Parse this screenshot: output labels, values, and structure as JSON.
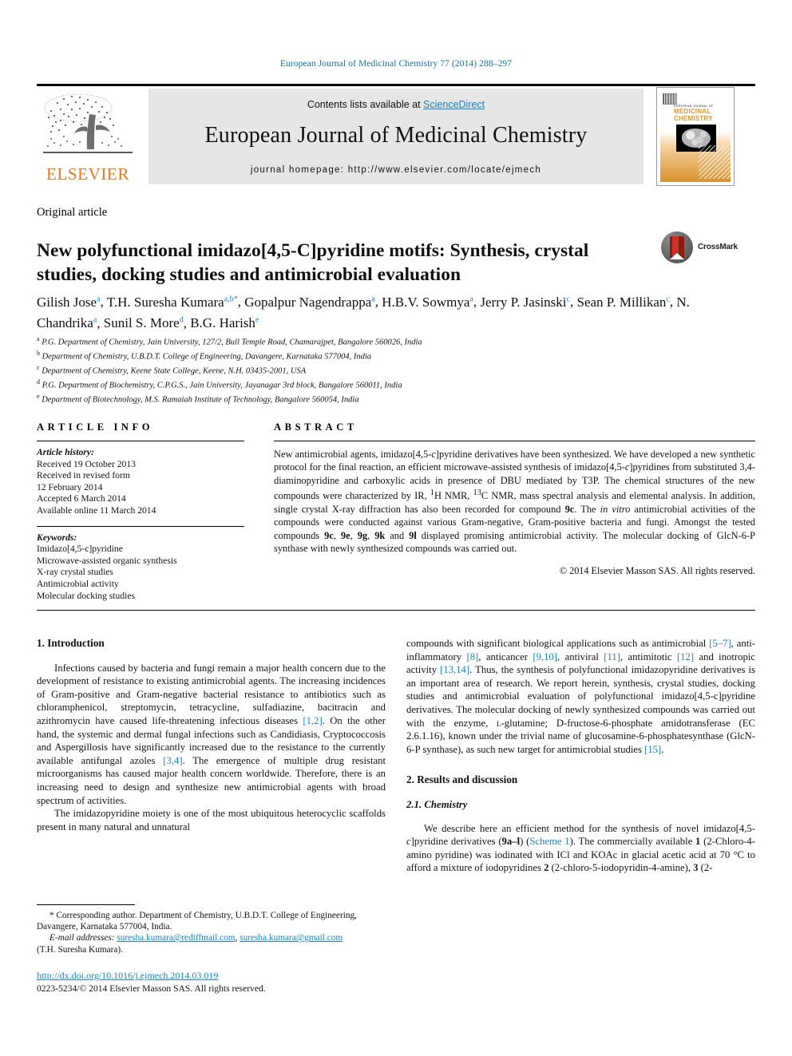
{
  "running_head": "European Journal of Medicinal Chemistry 77 (2014) 288–297",
  "header": {
    "contents_prefix": "Contents lists available at ",
    "sciencedirect": "ScienceDirect",
    "journal_title": "European Journal of Medicinal Chemistry",
    "homepage": "journal homepage: http://www.elsevier.com/locate/ejmech",
    "publisher_logo_text": "ELSEVIER",
    "cover": {
      "line1": "EUROPEAN JOURNAL OF",
      "line2": "MEDICINAL",
      "line3": "CHEMISTRY"
    }
  },
  "article": {
    "type": "Original article",
    "title": "New polyfunctional imidazo[4,5-C]pyridine motifs: Synthesis, crystal studies, docking studies and antimicrobial evaluation",
    "crossmark_label": "CrossMark"
  },
  "authors": [
    {
      "name": "Gilish Jose",
      "marks": "a"
    },
    {
      "name": "T.H. Suresha Kumara",
      "marks": "a,b",
      "corresponding": true
    },
    {
      "name": "Gopalpur Nagendrappa",
      "marks": "a"
    },
    {
      "name": "H.B.V. Sowmya",
      "marks": "a"
    },
    {
      "name": "Jerry P. Jasinski",
      "marks": "c"
    },
    {
      "name": "Sean P. Millikan",
      "marks": "c"
    },
    {
      "name": "N. Chandrika",
      "marks": "a"
    },
    {
      "name": "Sunil S. More",
      "marks": "d"
    },
    {
      "name": "B.G. Harish",
      "marks": "e"
    }
  ],
  "affiliations": [
    {
      "mark": "a",
      "text": "P.G. Department of Chemistry, Jain University, 127/2, Bull Temple Road, Chamarajpet, Bangalore 560026, India"
    },
    {
      "mark": "b",
      "text": "Department of Chemistry, U.B.D.T. College of Engineering, Davangere, Karnataka 577004, India"
    },
    {
      "mark": "c",
      "text": "Department of Chemistry, Keene State College, Keene, N.H. 03435-2001, USA"
    },
    {
      "mark": "d",
      "text": "P.G. Department of Biochemistry, C.P.G.S., Jain University, Jayanagar 3rd block, Bangalore 560011, India"
    },
    {
      "mark": "e",
      "text": "Department of Biotechnology, M.S. Ramaiah Institute of Technology, Bangalore 560054, India"
    }
  ],
  "article_info": {
    "heading": "ARTICLE INFO",
    "history_label": "Article history:",
    "history": [
      "Received 19 October 2013",
      "Received in revised form",
      "12 February 2014",
      "Accepted 6 March 2014",
      "Available online 11 March 2014"
    ],
    "keywords_label": "Keywords:",
    "keywords": [
      "Imidazo[4,5-c]pyridine",
      "Microwave-assisted organic synthesis",
      "X-ray crystal studies",
      "Antimicrobial activity",
      "Molecular docking studies"
    ]
  },
  "abstract": {
    "heading": "ABSTRACT",
    "copyright": "© 2014 Elsevier Masson SAS. All rights reserved."
  },
  "sections": {
    "introduction_heading": "1. Introduction",
    "results_heading": "2. Results and discussion",
    "chemistry_heading": "2.1. Chemistry"
  },
  "footnote": {
    "corresponding": "* Corresponding author. Department of Chemistry, U.B.D.T. College of Engineering, Davangere, Karnataka 577004, India.",
    "email_label": "E-mail addresses:",
    "email1": "suresha.kumara@rediffmail.com",
    "email2": "suresha.kumara@gmail.com",
    "email_owner": "(T.H. Suresha Kumara).",
    "doi": "http://dx.doi.org/10.1016/j.ejmech.2014.03.019",
    "issn": "0223-5234/© 2014 Elsevier Masson SAS. All rights reserved."
  },
  "colors": {
    "link": "#1a82c4",
    "running_head": "#1a6faf",
    "elsevier_orange": "#E87722",
    "band_gray": "#e6e6e6"
  }
}
